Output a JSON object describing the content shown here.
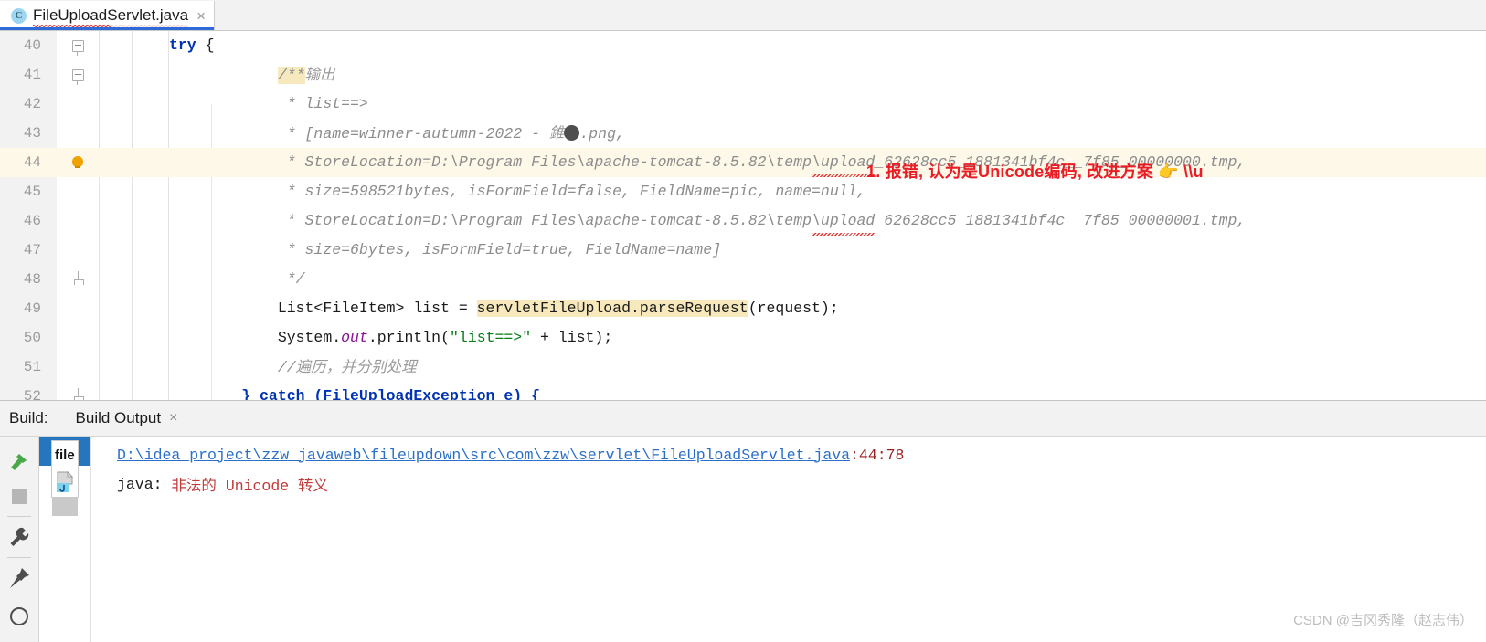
{
  "tab": {
    "icon": "java-class-icon",
    "label": "FileUploadServlet.java",
    "close": "×"
  },
  "editor": {
    "lines": [
      {
        "number": "40",
        "fold": "minus-tailed",
        "marker": "",
        "highlight": false,
        "text": "        try {"
      },
      {
        "number": "41",
        "fold": "minus-tailed",
        "marker": "",
        "highlight": false,
        "text": "            /**输出"
      },
      {
        "number": "42",
        "fold": "",
        "marker": "",
        "highlight": false,
        "text": "             * list==>"
      },
      {
        "number": "43",
        "fold": "",
        "marker": "",
        "highlight": false,
        "text": "             * [name=winner-autumn-2022 - 錐●.png,"
      },
      {
        "number": "44",
        "fold": "",
        "marker": "lightbulb-icon",
        "highlight": true,
        "text": "             * StoreLocation=D:\\Program Files\\apache-tomcat-8.5.82\\temp\\upload_62628cc5_1881341bf4c__7f85_00000000.tmp,"
      },
      {
        "number": "45",
        "fold": "",
        "marker": "",
        "highlight": false,
        "text": "             * size=598521bytes, isFormField=false, FieldName=pic, name=null,"
      },
      {
        "number": "46",
        "fold": "",
        "marker": "",
        "highlight": false,
        "text": "             * StoreLocation=D:\\Program Files\\apache-tomcat-8.5.82\\temp\\upload_62628cc5_1881341bf4c__7f85_00000001.tmp,"
      },
      {
        "number": "47",
        "fold": "",
        "marker": "",
        "highlight": false,
        "text": "             * size=6bytes, isFormField=true, FieldName=name]"
      },
      {
        "number": "48",
        "fold": "end",
        "marker": "",
        "highlight": false,
        "text": "             */"
      },
      {
        "number": "49",
        "fold": "",
        "marker": "",
        "highlight": false,
        "text": "            List<FileItem> list = servletFileUpload.parseRequest(request);"
      },
      {
        "number": "50",
        "fold": "",
        "marker": "",
        "highlight": false,
        "text": "            System.out.println(\"list==>\" + list);"
      },
      {
        "number": "51",
        "fold": "",
        "marker": "",
        "highlight": false,
        "text": "            //遍历，并分别处理"
      },
      {
        "number": "52",
        "fold": "",
        "marker": "",
        "highlight": false,
        "text": "        } catch (FileUploadException e) {"
      }
    ],
    "fragments": {
      "l40_kw": "try",
      "l40_rest": " {",
      "l41_indent": "            ",
      "l41_doc": "/**",
      "l41_cjk": "输出",
      "l42": "             * list==>",
      "l43_pre": "             * [name=winner-autumn-2022 - ",
      "l43_cjk": "錐",
      "l43_post": ".png,",
      "l44_a": "             * StoreLocation=D:\\Program Files\\apache-tomcat-8.5.82\\temp",
      "l44_squig": "\\upload",
      "l44_b": "_62628cc5_1881341bf4c__7f85_00000000.tmp,",
      "l45": "             * size=598521bytes, isFormField=false, FieldName=pic, name=null,",
      "l46_a": "             * StoreLocation=D:\\Program Files\\apache-tomcat-8.5.82\\temp",
      "l46_squig": "\\upload",
      "l46_b": "_62628cc5_1881341bf4c__7f85_00000001.tmp,",
      "l47": "             * size=6bytes, isFormField=true, FieldName=name]",
      "l48": "             */",
      "l49_a": "            List<FileItem> list = ",
      "l49_hl": "servletFileUpload.parseRequest",
      "l49_b": "(request);",
      "l50_a": "            System.",
      "l50_out": "out",
      "l50_b": ".println(",
      "l50_str": "\"list==>\"",
      "l50_c": " + list);",
      "l51_a": "            //",
      "l51_cjk": "遍历，并分别处理",
      "l52": "        } catch (FileUploadException e) {"
    }
  },
  "annotation": {
    "prefix": "1. 报错, 认为是Unicode编码, 改进方案 ",
    "hand": "👉",
    "suffix": " \\\\u"
  },
  "build": {
    "panel_title": "Build:",
    "tab_label": "Build Output",
    "tab_close": "×",
    "toolbar": [
      {
        "name": "build-hammer-icon",
        "title": "Build"
      },
      {
        "name": "stop-icon",
        "title": "Stop"
      },
      {
        "name": "wrench-settings-icon",
        "title": "Settings"
      },
      {
        "name": "pin-icon",
        "title": "Pin"
      },
      {
        "name": "help-icon",
        "title": "Help"
      }
    ],
    "file_chip_label": "file",
    "error_badge": "!",
    "output": {
      "link": "D:\\idea_project\\zzw_javaweb\\fileupdown\\src\\com\\zzw\\servlet\\FileUploadServlet.java",
      "location": ":44:78",
      "message_label": "java: ",
      "message_text": "非法的 Unicode 转义"
    }
  },
  "watermark": "CSDN @吉冈秀隆（赵志伟）",
  "colors": {
    "accent_blue": "#2f6bd8",
    "selection_blue": "#2675bf",
    "annotation_red": "#ea1c26",
    "error_red": "#c03a38",
    "link_blue": "#2a6fc9",
    "highlight_yellow": "#fdf8e8"
  }
}
